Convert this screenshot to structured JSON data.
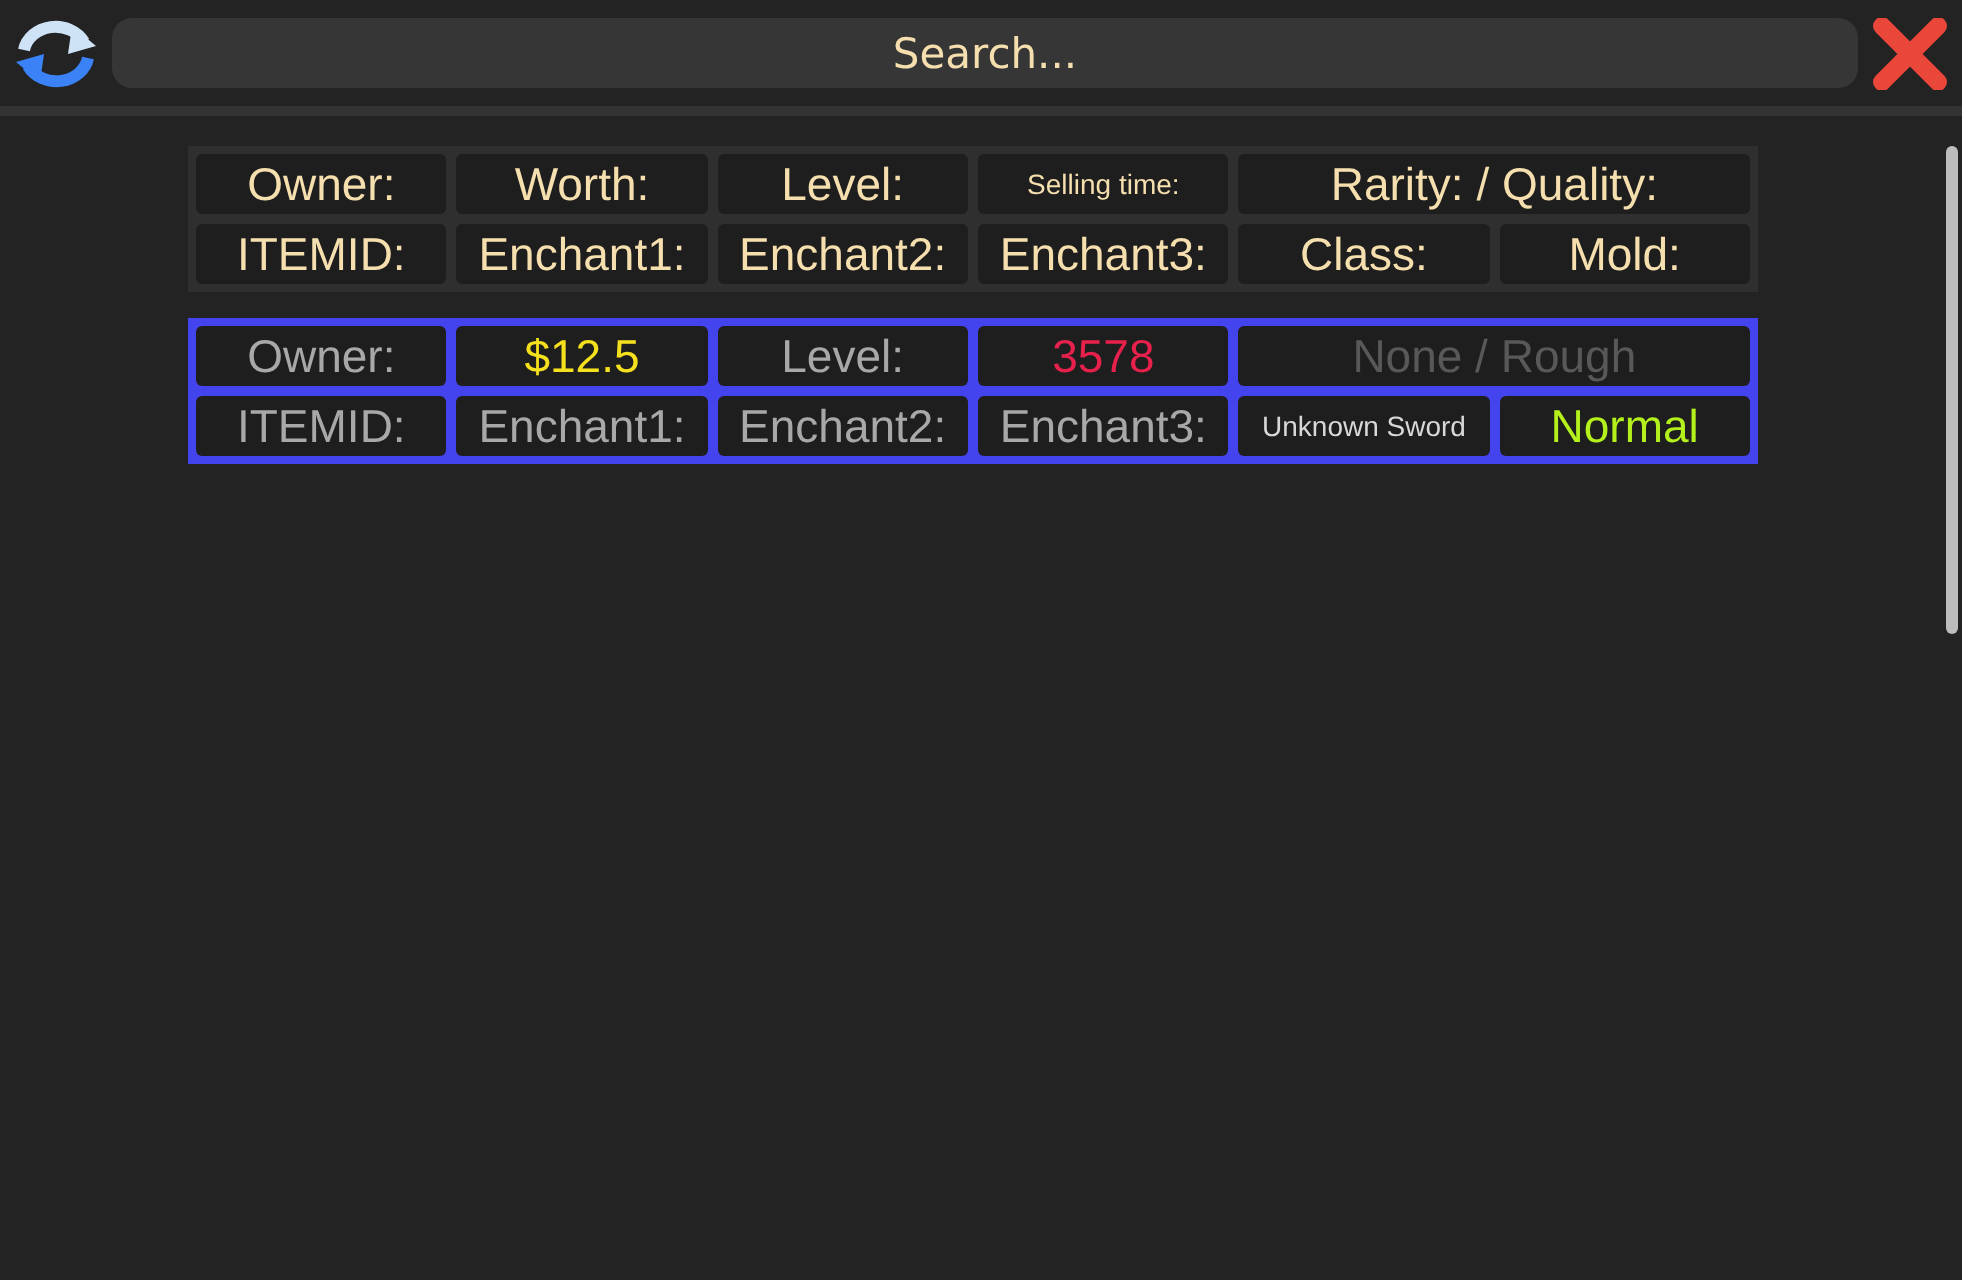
{
  "search": {
    "placeholder": "Search..."
  },
  "header": {
    "rows": [
      [
        {
          "text": "Owner:",
          "kind": "large"
        },
        {
          "text": "Worth:",
          "kind": "large"
        },
        {
          "text": "Level:",
          "kind": "large"
        },
        {
          "text": "Selling time:",
          "kind": "small"
        },
        {
          "text": "Rarity: / Quality:",
          "kind": "wide"
        }
      ],
      [
        {
          "text": "ITEMID:",
          "kind": "large"
        },
        {
          "text": "Enchant1:",
          "kind": "large"
        },
        {
          "text": "Enchant2:",
          "kind": "large"
        },
        {
          "text": "Enchant3:",
          "kind": "large"
        },
        {
          "text": "Class:",
          "kind": "large"
        },
        {
          "text": "Mold:",
          "kind": "large"
        }
      ]
    ]
  },
  "items": [
    {
      "selected": true,
      "rows": [
        [
          {
            "text": "Owner:",
            "kind": "large",
            "color": "#a8a8a8"
          },
          {
            "text": "$12.5",
            "kind": "large",
            "color": "#f4e01c"
          },
          {
            "text": "Level:",
            "kind": "large",
            "color": "#a8a8a8"
          },
          {
            "text": "3578",
            "kind": "large",
            "color": "#e8204c"
          },
          {
            "text": "None / Rough",
            "kind": "wide",
            "color": "#585858"
          }
        ],
        [
          {
            "text": "ITEMID:",
            "kind": "large",
            "color": "#a8a8a8"
          },
          {
            "text": "Enchant1:",
            "kind": "large",
            "color": "#a8a8a8"
          },
          {
            "text": "Enchant2:",
            "kind": "large",
            "color": "#a8a8a8"
          },
          {
            "text": "Enchant3:",
            "kind": "large",
            "color": "#a8a8a8"
          },
          {
            "text": "Unknown Sword",
            "kind": "small",
            "color": "#d8d8d8"
          },
          {
            "text": "Normal",
            "kind": "large",
            "color": "#b4f01c"
          }
        ]
      ]
    }
  ]
}
